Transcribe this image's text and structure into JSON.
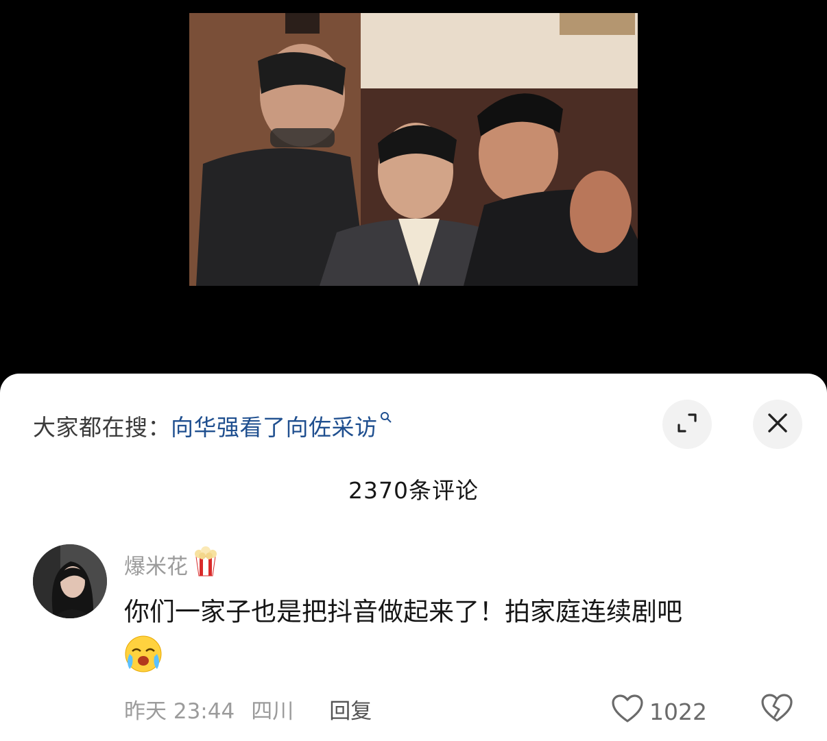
{
  "search": {
    "prefix": "大家都在搜：",
    "query": "向华强看了向佐采访"
  },
  "comments_header": {
    "count_label": "2370条评论"
  },
  "comment": {
    "username": "爆米花",
    "text": "你们一家子也是把抖音做起来了！拍家庭连续剧吧",
    "time": "昨天 23:44",
    "location": "四川",
    "reply_label": "回复",
    "likes": "1022"
  },
  "icons": {
    "expand": "expand-icon",
    "close": "close-icon",
    "search": "search-icon",
    "popcorn": "popcorn-icon",
    "crying_emoji": "crying-laughing-emoji",
    "like": "heart-icon",
    "dislike": "broken-heart-icon"
  },
  "colors": {
    "link": "#1f4f8f",
    "muted": "#9b9b9b",
    "text": "#161616"
  }
}
